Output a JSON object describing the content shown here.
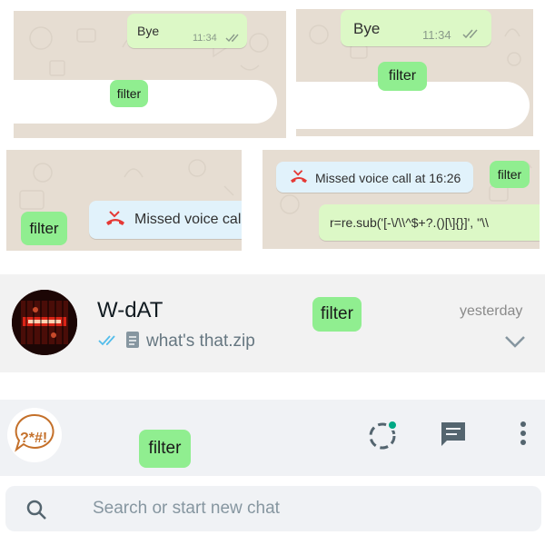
{
  "panel1": {
    "message": "Bye",
    "time": "11:34",
    "filter_label": "filter"
  },
  "panel2": {
    "message": "Bye",
    "time": "11:34",
    "filter_label": "filter"
  },
  "panel3": {
    "missed_call": "Missed voice call",
    "filter_label": "filter"
  },
  "panel4": {
    "missed_call": "Missed voice call at 16:26",
    "filter_label": "filter",
    "code_message": "r=re.sub('[-\\/\\\\^$+?.()[\\]{}]', \"\\\\"
  },
  "chat_row": {
    "name": "W-dAT",
    "last_message": "what's that.zip",
    "time": "yesterday",
    "filter_label": "filter"
  },
  "app_header": {
    "filter_label": "filter",
    "logo_text": "?*#!"
  },
  "search": {
    "placeholder": "Search or start new chat"
  },
  "colors": {
    "bubble_out": "#dcf8c6",
    "bubble_in": "#e1f2fb",
    "filter_highlight": "#90ee90",
    "missed_call_red": "#e53935",
    "read_ticks": "#4fc3f7",
    "status_dot": "#00a884"
  }
}
